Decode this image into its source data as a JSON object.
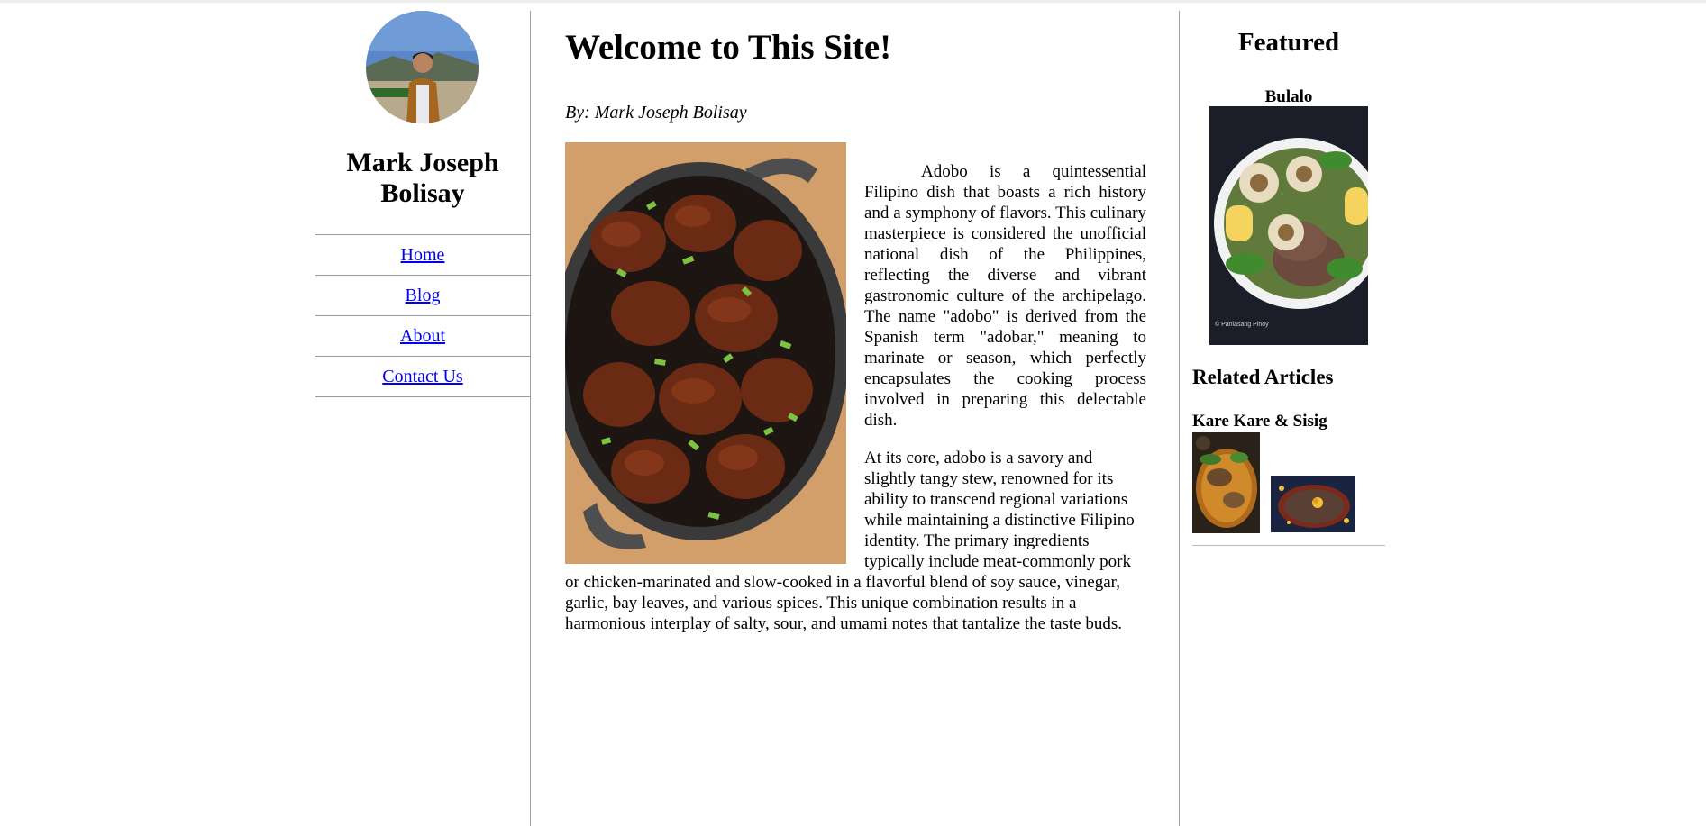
{
  "author": {
    "name": "Mark Joseph Bolisay"
  },
  "nav": {
    "items": [
      {
        "label": "Home"
      },
      {
        "label": "Blog"
      },
      {
        "label": "About"
      },
      {
        "label": "Contact Us"
      }
    ]
  },
  "article": {
    "title": "Welcome to This Site!",
    "byline": "By: Mark Joseph Bolisay",
    "paragraphs": [
      "Adobo is a quintessential Filipino dish that boasts a rich history and a symphony of flavors. This culinary masterpiece is considered the unofficial national dish of the Philippines, reflecting the diverse and vibrant gastronomic culture of the archipelago. The name \"adobo\" is derived from the Spanish term \"adobar,\" meaning to marinate or season, which perfectly encapsulates the cooking process involved in preparing this delectable dish.",
      "At its core, adobo is a savory and slightly tangy stew, renowned for its ability to transcend regional variations while maintaining a distinctive Filipino identity. The primary ingredients typically include meat-commonly pork or chicken-marinated and slow-cooked in a flavorful blend of soy sauce, vinegar, garlic, bay leaves, and various spices. This unique combination results in a harmonious interplay of salty, sour, and umami notes that tantalize the taste buds."
    ]
  },
  "aside": {
    "featured_heading": "Featured",
    "featured_title": "Bulalo",
    "featured_credit": "© Panlasang Pinoy",
    "related_heading": "Related Articles",
    "related_title": "Kare Kare & Sisig"
  },
  "colors": {
    "link": "#0000ee",
    "divider": "#a0a0a0"
  }
}
